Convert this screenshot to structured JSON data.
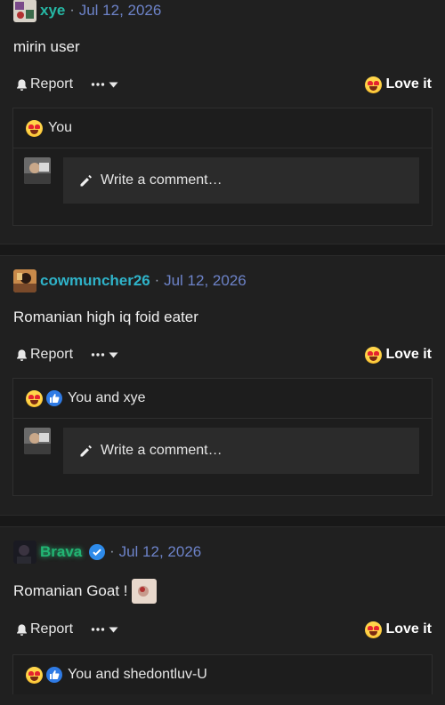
{
  "posts": [
    {
      "username": "xye",
      "username_color": "#26b8a5",
      "date": "Jul 12, 2026",
      "text": "mirin user",
      "report_label": "Report",
      "love_label": "Love it",
      "reactions_text": "You",
      "comment_placeholder": "Write a comment…"
    },
    {
      "username": "cowmuncher26",
      "username_color": "#2fb3c9",
      "date": "Jul 12, 2026",
      "text": "Romanian high iq foid eater",
      "report_label": "Report",
      "love_label": "Love it",
      "reactions_text": "You and xye",
      "comment_placeholder": "Write a comment…"
    },
    {
      "username": "Brava",
      "username_color": "#22b573",
      "date": "Jul 12, 2026",
      "text": "Romanian Goat !",
      "report_label": "Report",
      "love_label": "Love it",
      "reactions_text": "You and shedontluv-U"
    }
  ],
  "separator": "·",
  "icons": {
    "report": "bell-icon",
    "more": "ellipsis-icon",
    "dropdown": "chevron-down-icon",
    "love": "star-struck-emoji-icon",
    "like": "thumbs-up-icon",
    "edit": "pencil-icon",
    "verified": "verified-check-icon"
  }
}
